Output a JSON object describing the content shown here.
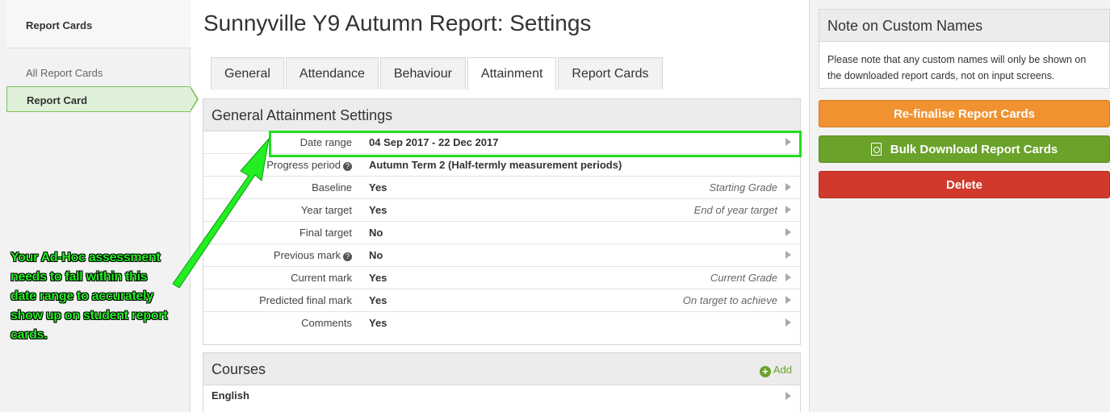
{
  "sidebar": {
    "header": "Report Cards",
    "items": [
      {
        "label": "All Report Cards"
      },
      {
        "label": "Report Card"
      }
    ]
  },
  "main": {
    "title": "Sunnyville Y9 Autumn Report: Settings",
    "tabs": [
      {
        "label": "General"
      },
      {
        "label": "Attendance"
      },
      {
        "label": "Behaviour"
      },
      {
        "label": "Attainment",
        "active": true
      },
      {
        "label": "Report Cards"
      }
    ],
    "attainment": {
      "heading": "General Attainment Settings",
      "rows": [
        {
          "label": "Date range",
          "value": "04 Sep 2017 - 22 Dec 2017",
          "note": ""
        },
        {
          "label": "Progress period",
          "value": "Autumn Term 2 (Half-termly measurement periods)",
          "note": ""
        },
        {
          "label": "Baseline",
          "value": "Yes",
          "note": "Starting Grade"
        },
        {
          "label": "Year target",
          "value": "Yes",
          "note": "End of year target"
        },
        {
          "label": "Final target",
          "value": "No",
          "note": ""
        },
        {
          "label": "Previous mark",
          "value": "No",
          "note": ""
        },
        {
          "label": "Current mark",
          "value": "Yes",
          "note": "Current Grade"
        },
        {
          "label": "Predicted final mark",
          "value": "Yes",
          "note": "On target to achieve"
        },
        {
          "label": "Comments",
          "value": "Yes",
          "note": ""
        }
      ],
      "help_glyph": "?"
    },
    "courses": {
      "heading": "Courses",
      "add_label": "Add",
      "add_glyph": "+",
      "items": [
        {
          "label": "English"
        }
      ]
    }
  },
  "right": {
    "note_title": "Note on Custom Names",
    "note_text": "Please note that any custom names will only be shown on the downloaded report cards, not on input screens.",
    "buttons": {
      "refinalise": "Re-finalise Report Cards",
      "bulk_download": "Bulk Download Report Cards",
      "delete": "Delete"
    }
  },
  "annotation": {
    "text": "Your Ad-Hoc assessment needs to fall within this date range to accurately show up on student report cards."
  },
  "colors": {
    "accent_green": "#6aa22a",
    "orange": "#f0922f",
    "red": "#d0392b",
    "highlight": "#22dd22"
  }
}
